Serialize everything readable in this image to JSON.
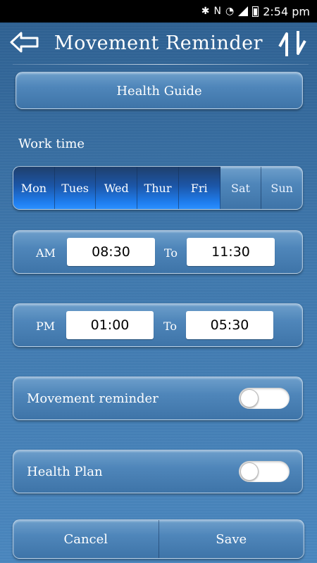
{
  "status_bar": {
    "time": "2:54 pm",
    "icons": [
      "bluetooth-icon",
      "nfc-icon",
      "wifi-icon",
      "signal-icon",
      "battery-icon"
    ]
  },
  "header": {
    "title": "Movement Reminder",
    "back_icon": "back-arrow-icon",
    "swap_icon": "swap-arrows-icon"
  },
  "health_guide": {
    "label": "Health Guide"
  },
  "work_time": {
    "label": "Work time",
    "days": [
      {
        "label": "Mon",
        "selected": true
      },
      {
        "label": "Tues",
        "selected": true
      },
      {
        "label": "Wed",
        "selected": true
      },
      {
        "label": "Thur",
        "selected": true
      },
      {
        "label": "Fri",
        "selected": true
      },
      {
        "label": "Sat",
        "selected": false
      },
      {
        "label": "Sun",
        "selected": false
      }
    ]
  },
  "am": {
    "label": "AM",
    "start": "08:30",
    "to": "To",
    "end": "11:30"
  },
  "pm": {
    "label": "PM",
    "start": "01:00",
    "to": "To",
    "end": "05:30"
  },
  "movement_reminder": {
    "label": "Movement reminder",
    "enabled": false
  },
  "health_plan": {
    "label": "Health Plan",
    "enabled": false
  },
  "actions": {
    "cancel": "Cancel",
    "save": "Save"
  },
  "colors": {
    "selected_day": "#1f7ef0",
    "background": "#3f78ad"
  }
}
